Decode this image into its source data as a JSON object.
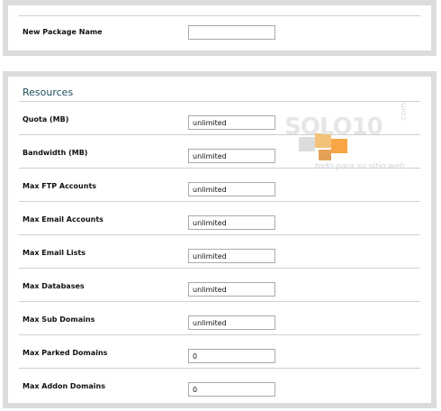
{
  "top_panel": {
    "new_package_label": "New Package Name",
    "new_package_value": ""
  },
  "resources": {
    "title": "Resources",
    "rows": [
      {
        "label": "Quota (MB)",
        "value": "unlimited"
      },
      {
        "label": "Bandwidth (MB)",
        "value": "unlimited"
      },
      {
        "label": "Max FTP Accounts",
        "value": "unlimited"
      },
      {
        "label": "Max Email Accounts",
        "value": "unlimited"
      },
      {
        "label": "Max Email Lists",
        "value": "unlimited"
      },
      {
        "label": "Max Databases",
        "value": "unlimited"
      },
      {
        "label": "Max Sub Domains",
        "value": "unlimited"
      },
      {
        "label": "Max Parked Domains",
        "value": "0"
      },
      {
        "label": "Max Addon Domains",
        "value": "0"
      }
    ]
  },
  "watermark": {
    "brand": "SOLO10",
    "domain_suffix": ".com",
    "tagline": "todo para su sitio web",
    "colors": [
      "#f2c27a",
      "#f7a545",
      "#c8c8c8",
      "#e08a2e"
    ]
  }
}
